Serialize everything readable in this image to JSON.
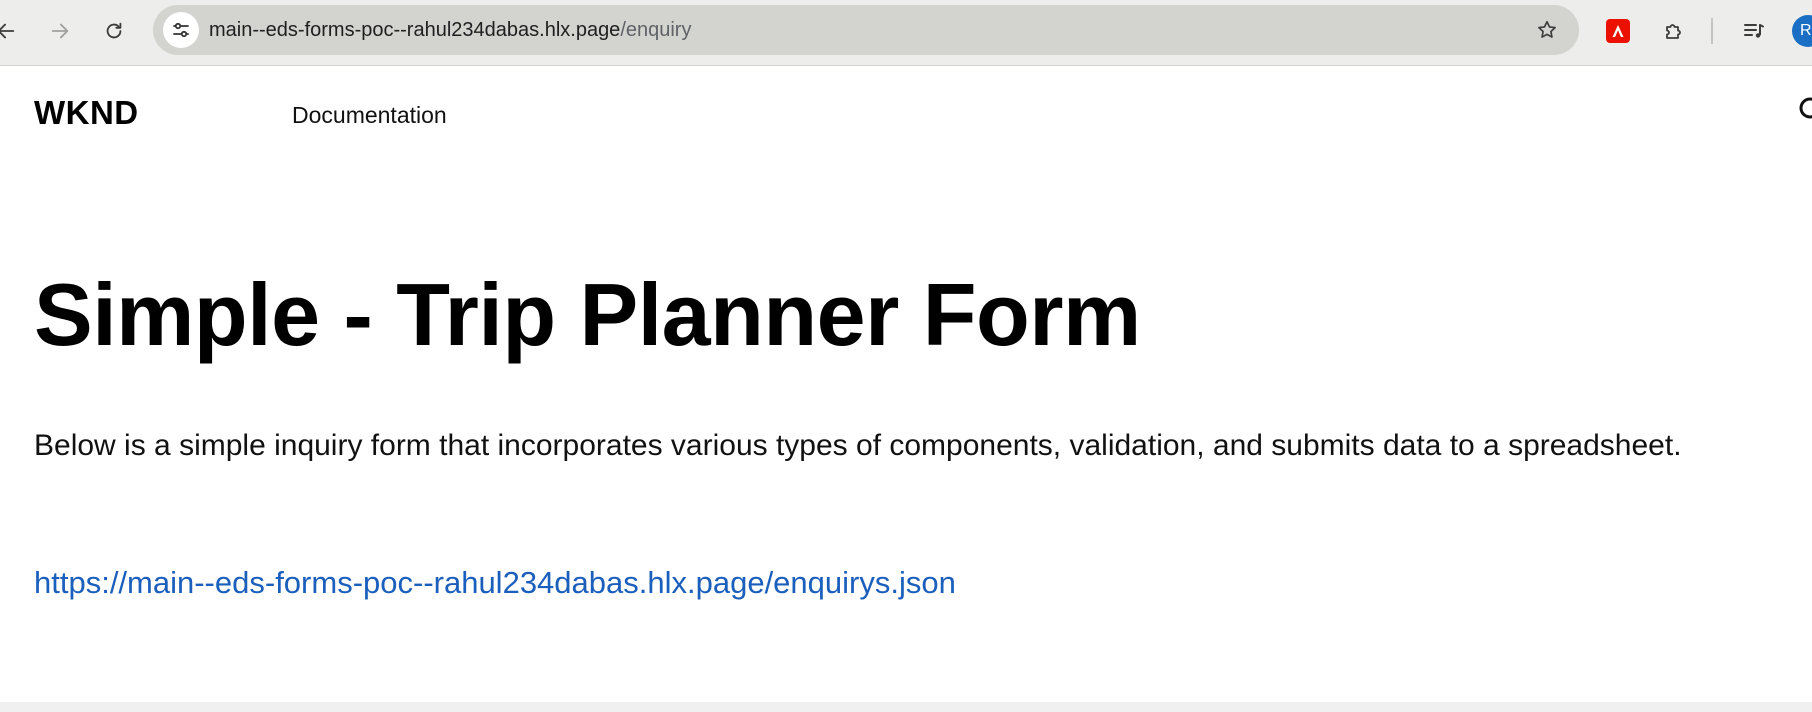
{
  "browser": {
    "url_host": "main--eds-forms-poc--rahul234dabas.hlx.page",
    "url_path": "/enquiry",
    "back_icon": "arrow-left-icon",
    "forward_icon": "arrow-right-icon",
    "reload_icon": "reload-icon",
    "site_info_icon": "tune-icon",
    "bookmark_icon": "star-outline-icon",
    "extensions": [
      "acrobat-icon",
      "puzzle-icon"
    ],
    "media_icon": "media-queue-icon",
    "profile_initial": "R",
    "colors": {
      "toolbar_bg": "#ededeb",
      "omnibox_bg": "#d3d3cf",
      "acrobat_red": "#eb1000",
      "profile_blue": "#1a6fc4"
    }
  },
  "header": {
    "brand": "WKND",
    "nav": [
      {
        "label": "Documentation"
      }
    ],
    "search_icon": "search-icon"
  },
  "main": {
    "title": "Simple - Trip Planner Form",
    "intro": "Below is a simple inquiry form that incorporates various types of components, validation, and submits data to a spreadsheet.",
    "link_text": "https://main--eds-forms-poc--rahul234dabas.hlx.page/enquirys.json",
    "link_color": "#1b5fbd"
  }
}
